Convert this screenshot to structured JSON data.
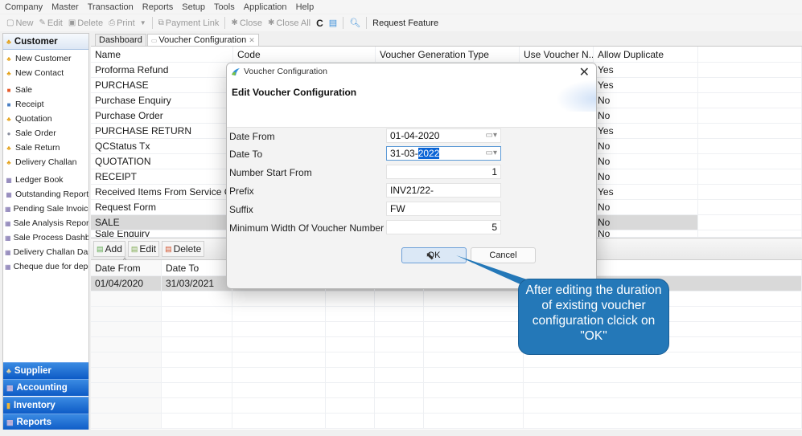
{
  "menubar": [
    "Company",
    "Master",
    "Transaction",
    "Reports",
    "Setup",
    "Tools",
    "Application",
    "Help"
  ],
  "toolbar": {
    "new": "New",
    "edit": "Edit",
    "delete": "Delete",
    "print": "Print",
    "payment_link": "Payment Link",
    "close": "Close",
    "close_all": "Close All",
    "request_feature": "Request Feature"
  },
  "sidebar": {
    "header": "Customer",
    "items": [
      {
        "label": "New Customer",
        "icon": "person-icon"
      },
      {
        "label": "New Contact",
        "icon": "person-icon"
      },
      {
        "label": "Sale",
        "icon": "sale-icon"
      },
      {
        "label": "Receipt",
        "icon": "receipt-icon"
      },
      {
        "label": "Quotation",
        "icon": "person-icon"
      },
      {
        "label": "Sale Order",
        "icon": "order-icon"
      },
      {
        "label": "Sale Return",
        "icon": "person-icon"
      },
      {
        "label": "Delivery Challan",
        "icon": "person-icon"
      },
      {
        "label": "Ledger Book",
        "icon": "report-icon"
      },
      {
        "label": "Outstanding Report",
        "icon": "report-icon"
      },
      {
        "label": "Pending Sale Invoices",
        "icon": "report-icon"
      },
      {
        "label": "Sale Analysis Report",
        "icon": "report-icon"
      },
      {
        "label": "Sale Process Dashboard",
        "icon": "report-icon"
      },
      {
        "label": "Delivery Challan Dashboard",
        "icon": "report-icon"
      },
      {
        "label": "Cheque due for deposit",
        "icon": "report-icon"
      }
    ],
    "categories": [
      "Supplier",
      "Accounting",
      "Inventory",
      "Reports"
    ]
  },
  "tabs": [
    {
      "label": "Dashboard",
      "active": false
    },
    {
      "label": "Voucher Configuration",
      "active": true
    }
  ],
  "grid": {
    "columns": [
      "Name",
      "Code",
      "Voucher Generation Type",
      "Use Voucher N...",
      "Allow Duplicate",
      ""
    ],
    "rows": [
      {
        "name": "Proforma Refund",
        "allow_duplicate": "Yes"
      },
      {
        "name": "PURCHASE",
        "allow_duplicate": "Yes"
      },
      {
        "name": "Purchase Enquiry",
        "allow_duplicate": "No"
      },
      {
        "name": "Purchase Order",
        "allow_duplicate": "No"
      },
      {
        "name": "PURCHASE RETURN",
        "allow_duplicate": "Yes"
      },
      {
        "name": "QCStatus Tx",
        "allow_duplicate": "No"
      },
      {
        "name": "QUOTATION",
        "allow_duplicate": "No"
      },
      {
        "name": "RECEIPT",
        "allow_duplicate": "No"
      },
      {
        "name": "Received Items From Service C...",
        "allow_duplicate": "Yes"
      },
      {
        "name": "Request Form",
        "allow_duplicate": "No"
      },
      {
        "name": "SALE",
        "allow_duplicate": "No",
        "selected": true
      },
      {
        "name": "Sale Enquiry",
        "allow_duplicate": "No"
      }
    ]
  },
  "detail_buttons": {
    "add": "Add",
    "edit": "Edit",
    "delete": "Delete"
  },
  "detail_grid": {
    "columns": [
      "Date From",
      "Date To"
    ],
    "rows": [
      {
        "date_from": "01/04/2020",
        "date_to": "31/03/2021"
      }
    ]
  },
  "dialog": {
    "window_title": "Voucher Configuration",
    "heading": "Edit Voucher Configuration",
    "fields": {
      "date_from": {
        "label": "Date From",
        "value": "01-04-2020"
      },
      "date_to": {
        "label": "Date To",
        "value_prefix": "31-03-",
        "value_selected": "2022"
      },
      "number_start": {
        "label": "Number Start From",
        "value": "1"
      },
      "prefix": {
        "label": "Prefix",
        "value": "INV21/22-"
      },
      "suffix": {
        "label": "Suffix",
        "value": "FW"
      },
      "min_width": {
        "label": "Minimum Width Of Voucher Number",
        "value": "5"
      }
    },
    "ok": "OK",
    "cancel": "Cancel"
  },
  "callout": {
    "text": "After editing the duration of existing voucher configuration clcick on \"OK\"",
    "color": "#2478b8"
  }
}
